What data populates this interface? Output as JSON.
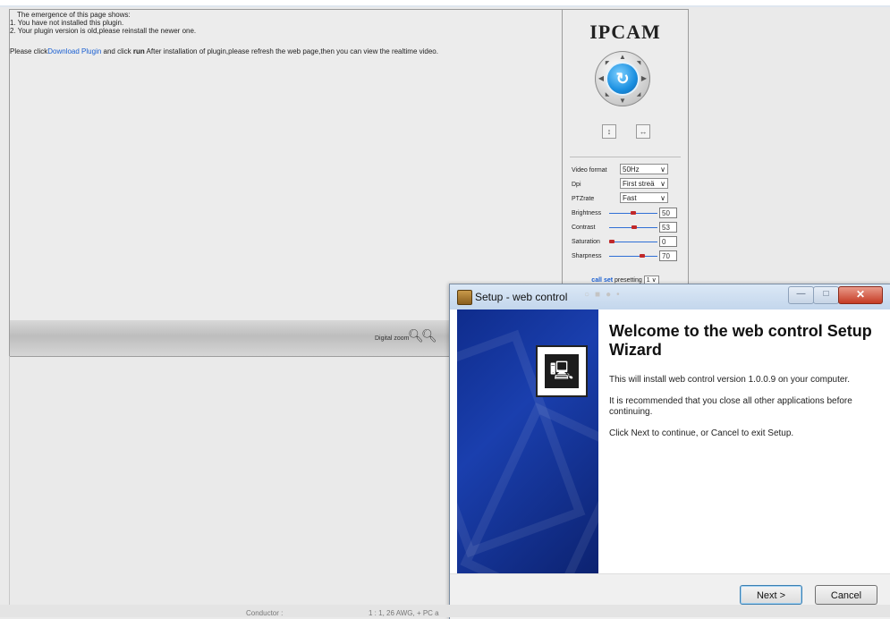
{
  "plugin_notice": {
    "header": "The emergence of this page shows:",
    "line1": "1. You have not installed this plugin.",
    "line2": "2. Your plugin version is old,please reinstall the newer one.",
    "msg_prefix": "Please click",
    "download_link": "Download Plugin",
    "msg_mid": " and click ",
    "msg_run": "run",
    "msg_suffix": " After installation of plugin,please refresh the web page,then you can view the realtime video."
  },
  "zoom": {
    "label": "Digital zoom"
  },
  "panel": {
    "logo": "IPCAM",
    "rows": {
      "video_format_label": "Video format",
      "video_format_value": "50Hz",
      "dpi_label": "Dpi",
      "dpi_value": "First streä",
      "ptzrate_label": "PTZrate",
      "ptzrate_value": "Fast"
    },
    "sliders": [
      {
        "label": "Brightness",
        "value": "50",
        "level": 0.5
      },
      {
        "label": "Contrast",
        "value": "53",
        "level": 0.53
      },
      {
        "label": "Saturation",
        "value": "0",
        "level": 0.0
      },
      {
        "label": "Sharpness",
        "value": "70",
        "level": 0.7
      }
    ],
    "preset": {
      "call": "call",
      "set": "set",
      "text": "presetting",
      "value": "1"
    }
  },
  "dialog": {
    "title": "Setup - web control",
    "heading": "Welcome to the web control Setup Wizard",
    "p1": "This will install web control version 1.0.0.9 on your computer.",
    "p2": "It is recommended that you close all other applications before continuing.",
    "p3": "Click Next to continue, or Cancel to exit Setup.",
    "next": "Next >",
    "cancel": "Cancel"
  },
  "bottom": {
    "conductor": "Conductor :",
    "spec": "1 : 1, 26 AWG, + PC a"
  },
  "colors": {
    "link": "#1a5fd1",
    "wizard_sidebar": "#1a3fae",
    "ptz_center": "#1a8fe0",
    "slider_knob": "#c0282a"
  }
}
